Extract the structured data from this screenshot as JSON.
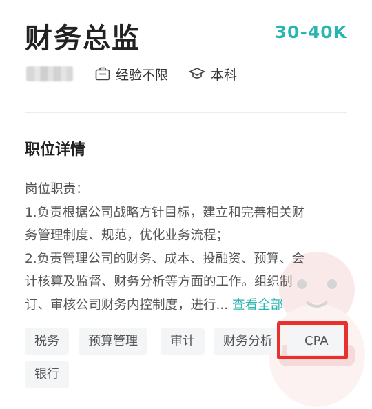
{
  "job": {
    "title": "财务总监",
    "salary": "30-40K"
  },
  "meta": {
    "experience": "经验不限",
    "education": "本科"
  },
  "details": {
    "section_title": "职位详情",
    "lines": [
      "岗位职责：",
      "1.负责根据公司战略方针目标，建立和完善相关财",
      "务管理制度、规范，优化业务流程；",
      "2.负责管理公司的财务、成本、投融资、预算、会",
      "计核算及监督、财务分析等方面的工作。组织制",
      "订、审核公司财务内控制度，进行..."
    ],
    "see_all": "查看全部"
  },
  "tags": [
    "税务",
    "预算管理",
    "审计",
    "财务分析",
    "CPA",
    "银行"
  ],
  "colors": {
    "accent": "#2bb5b0",
    "highlight": "#e8302f"
  }
}
